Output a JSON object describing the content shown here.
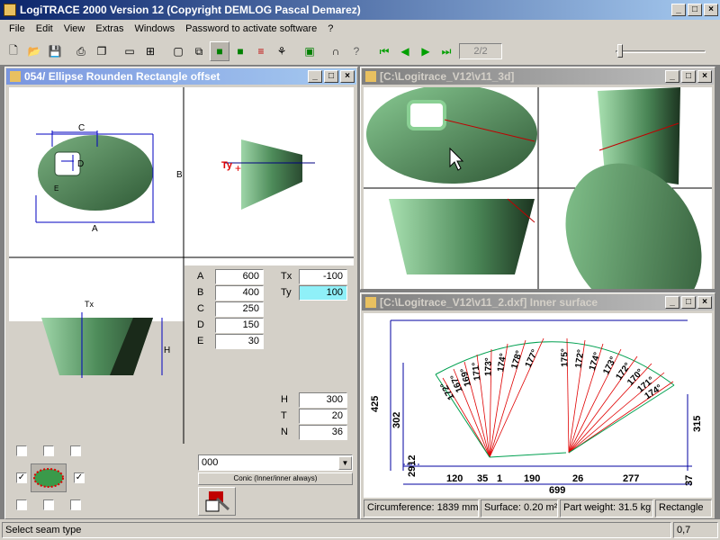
{
  "app": {
    "title": "LogiTRACE 2000  Version 12  (Copyright DEMLOG Pascal Demarez)"
  },
  "menu": [
    "File",
    "Edit",
    "View",
    "Extras",
    "Windows",
    "Password to activate software",
    "?"
  ],
  "toolbar": {
    "page_indicator": "2/2"
  },
  "left_window": {
    "title": "054/ Ellipse Rounden Rectangle offset",
    "params": [
      {
        "label": "A",
        "value": "600"
      },
      {
        "label": "B",
        "value": "400"
      },
      {
        "label": "C",
        "value": "250"
      },
      {
        "label": "D",
        "value": "150"
      },
      {
        "label": "E",
        "value": "30"
      }
    ],
    "offsets": [
      {
        "label": "Tx",
        "value": "-100"
      },
      {
        "label": "Ty",
        "value": "100"
      }
    ],
    "params2": [
      {
        "label": "H",
        "value": "300"
      },
      {
        "label": "T",
        "value": "20"
      },
      {
        "label": "N",
        "value": "36"
      }
    ],
    "combo_value": "000",
    "conic_button": "Conic (Inner/inner always)",
    "drawing_labels": {
      "c": "C",
      "d": "D",
      "b": "B",
      "a": "A",
      "e": "E",
      "ty": "Ty",
      "tx": "Tx",
      "h": "H"
    }
  },
  "view3d_window": {
    "title": "[C:\\Logitrace_V12\\v11_3d]"
  },
  "dxf_window": {
    "title": "[C:\\Logitrace_V12\\v11_2.dxf]  Inner surface",
    "dims": {
      "d425": "425",
      "d302": "302",
      "d315": "315",
      "d2912": "2912",
      "d37": "37",
      "d120": "120",
      "d35": "35",
      "d1": "1",
      "d190": "190",
      "d26": "26",
      "d277": "277",
      "d699": "699"
    },
    "angles": [
      "172°",
      "167°",
      "169°",
      "171°",
      "173°",
      "174°",
      "178°",
      "177°",
      "175°",
      "172°",
      "174°",
      "173°",
      "172°",
      "170°",
      "171°",
      "174°"
    ],
    "status": {
      "circumference": "Circumference: 1839 mm",
      "surface": "Surface: 0.20 m²",
      "weight": "Part weight: 31.5 kg",
      "shape": "Rectangle"
    }
  },
  "statusbar": {
    "message": "Select seam type",
    "value": "0,7"
  }
}
